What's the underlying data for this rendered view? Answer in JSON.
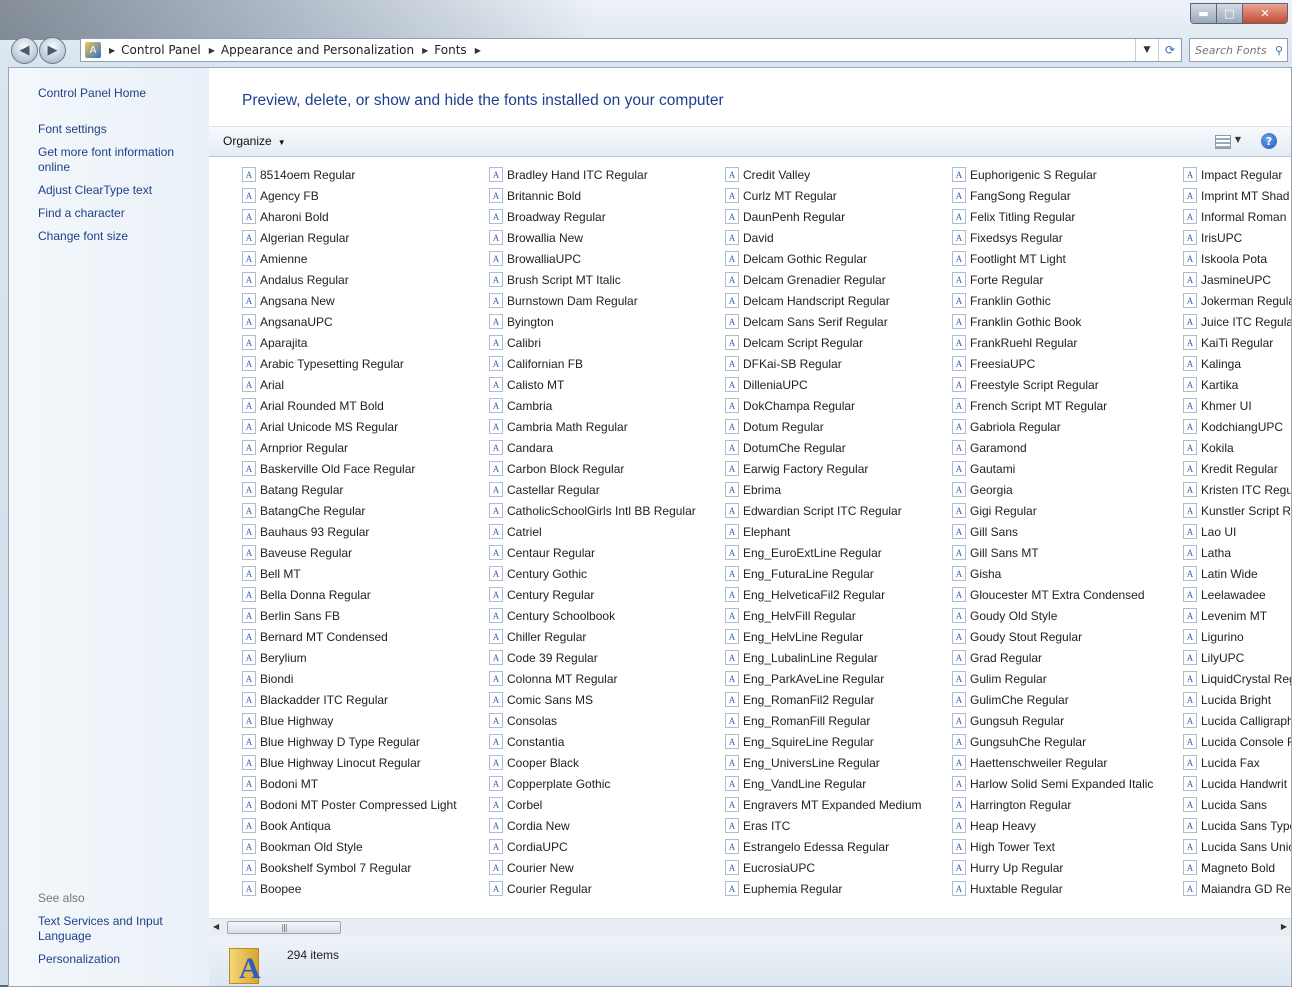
{
  "window": {
    "caption": {
      "minimize": "▬",
      "maximize": "□",
      "close": "✕"
    }
  },
  "nav": {
    "back_icon": "back-arrow-icon",
    "forward_icon": "forward-arrow-icon",
    "breadcrumbs": [
      "Control Panel",
      "Appearance and Personalization",
      "Fonts"
    ],
    "search_placeholder": "Search Fonts"
  },
  "sidebar": {
    "home": "Control Panel Home",
    "links": [
      "Font settings",
      "Get more font information online",
      "Adjust ClearType text",
      "Find a character",
      "Change font size"
    ],
    "see_also_label": "See also",
    "see_also": [
      "Text Services and Input Language",
      "Personalization"
    ]
  },
  "main": {
    "heading": "Preview, delete, or show and hide the fonts installed on your computer",
    "organize_label": "Organize",
    "help_label": "?",
    "status_count": "294 items"
  },
  "columns": [
    [
      "8514oem Regular",
      "Agency FB",
      "Aharoni Bold",
      "Algerian Regular",
      "Amienne",
      "Andalus Regular",
      "Angsana New",
      "AngsanaUPC",
      "Aparajita",
      "Arabic Typesetting Regular",
      "Arial",
      "Arial Rounded MT Bold",
      "Arial Unicode MS Regular",
      "Arnprior Regular",
      "Baskerville Old Face Regular",
      "Batang Regular",
      "BatangChe Regular",
      "Bauhaus 93 Regular",
      "Baveuse Regular",
      "Bell MT",
      "Bella Donna Regular",
      "Berlin Sans FB",
      "Bernard MT Condensed",
      "Berylium",
      "Biondi",
      "Blackadder ITC Regular",
      "Blue Highway",
      "Blue Highway D Type Regular",
      "Blue Highway Linocut Regular",
      "Bodoni MT",
      "Bodoni MT Poster Compressed Light",
      "Book Antiqua",
      "Bookman Old Style",
      "Bookshelf Symbol 7 Regular",
      "Boopee"
    ],
    [
      "Bradley Hand ITC Regular",
      "Britannic Bold",
      "Broadway Regular",
      "Browallia New",
      "BrowalliaUPC",
      "Brush Script MT Italic",
      "Burnstown Dam Regular",
      "Byington",
      "Calibri",
      "Californian FB",
      "Calisto MT",
      "Cambria",
      "Cambria Math Regular",
      "Candara",
      "Carbon Block Regular",
      "Castellar Regular",
      "CatholicSchoolGirls Intl BB Regular",
      "Catriel",
      "Centaur Regular",
      "Century Gothic",
      "Century Regular",
      "Century Schoolbook",
      "Chiller Regular",
      "Code 39 Regular",
      "Colonna MT Regular",
      "Comic Sans MS",
      "Consolas",
      "Constantia",
      "Cooper Black",
      "Copperplate Gothic",
      "Corbel",
      "Cordia New",
      "CordiaUPC",
      "Courier New",
      "Courier Regular"
    ],
    [
      "Credit Valley",
      "Curlz MT Regular",
      "DaunPenh Regular",
      "David",
      "Delcam Gothic Regular",
      "Delcam Grenadier Regular",
      "Delcam Handscript Regular",
      "Delcam Sans Serif Regular",
      "Delcam Script Regular",
      "DFKai-SB Regular",
      "DilleniaUPC",
      "DokChampa Regular",
      "Dotum Regular",
      "DotumChe Regular",
      "Earwig Factory Regular",
      "Ebrima",
      "Edwardian Script ITC Regular",
      "Elephant",
      "Eng_EuroExtLine Regular",
      "Eng_FuturaLine Regular",
      "Eng_HelveticaFil2 Regular",
      "Eng_HelvFill Regular",
      "Eng_HelvLine Regular",
      "Eng_LubalinLine Regular",
      "Eng_ParkAveLine Regular",
      "Eng_RomanFil2 Regular",
      "Eng_RomanFill Regular",
      "Eng_SquireLine Regular",
      "Eng_UniversLine Regular",
      "Eng_VandLine Regular",
      "Engravers MT Expanded Medium",
      "Eras ITC",
      "Estrangelo Edessa Regular",
      "EucrosiaUPC",
      "Euphemia Regular"
    ],
    [
      "Euphorigenic S Regular",
      "FangSong Regular",
      "Felix Titling Regular",
      "Fixedsys Regular",
      "Footlight MT Light",
      "Forte Regular",
      "Franklin Gothic",
      "Franklin Gothic Book",
      "FrankRuehl Regular",
      "FreesiaUPC",
      "Freestyle Script Regular",
      "French Script MT Regular",
      "Gabriola Regular",
      "Garamond",
      "Gautami",
      "Georgia",
      "Gigi Regular",
      "Gill Sans",
      "Gill Sans MT",
      "Gisha",
      "Gloucester MT Extra Condensed",
      "Goudy Old Style",
      "Goudy Stout Regular",
      "Grad Regular",
      "Gulim Regular",
      "GulimChe Regular",
      "Gungsuh Regular",
      "GungsuhChe Regular",
      "Haettenschweiler Regular",
      "Harlow Solid Semi Expanded Italic",
      "Harrington Regular",
      "Heap Heavy",
      "High Tower Text",
      "Hurry Up Regular",
      "Huxtable Regular"
    ],
    [
      "Impact Regular",
      "Imprint MT Shad",
      "Informal Roman",
      "IrisUPC",
      "Iskoola Pota",
      "JasmineUPC",
      "Jokerman Regula",
      "Juice ITC Regular",
      "KaiTi Regular",
      "Kalinga",
      "Kartika",
      "Khmer UI",
      "KodchiangUPC",
      "Kokila",
      "Kredit Regular",
      "Kristen ITC Regu",
      "Kunstler Script R",
      "Lao UI",
      "Latha",
      "Latin Wide",
      "Leelawadee",
      "Levenim MT",
      "Ligurino",
      "LilyUPC",
      "LiquidCrystal Reg",
      "Lucida Bright",
      "Lucida Calligraph",
      "Lucida Console R",
      "Lucida Fax",
      "Lucida Handwrit",
      "Lucida Sans",
      "Lucida Sans Type",
      "Lucida Sans Unic",
      "Magneto Bold",
      "Maiandra GD Re"
    ]
  ]
}
